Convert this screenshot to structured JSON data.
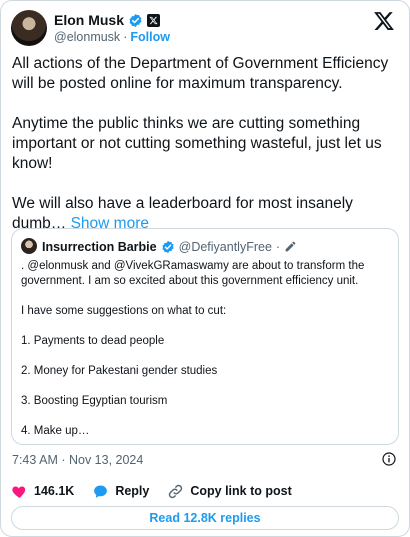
{
  "post": {
    "author_name": "Elon Musk",
    "author_handle": "@elonmusk",
    "separator": "·",
    "follow_label": "Follow",
    "paragraphs": [
      "All actions of the Department of Government Efficiency will be posted online for maximum transparency.",
      "Anytime the public thinks we are cutting something important or not cutting something wasteful, just let us know!"
    ],
    "truncated_paragraph": "We will also have a leaderboard for most insanely dumb…",
    "show_more_label": "Show more"
  },
  "quote": {
    "author_name": "Insurrection Barbie",
    "author_handle": "@DefiyantlyFree",
    "separator": "·",
    "intro": ". @elonmusk and @VivekGRamaswamy are about to transform the government. I am so excited about this government efficiency unit.",
    "lead": "I have some suggestions on what to cut:",
    "items": [
      "1.  Payments to dead people",
      "2. Money for Pakestani gender studies",
      "3. Boosting Egyptian tourism",
      "4. Make up…"
    ]
  },
  "meta": {
    "timestamp": "7:43 AM · Nov 13, 2024"
  },
  "actions": {
    "likes": "146.1K",
    "reply_label": "Reply",
    "copy_link_label": "Copy link to post",
    "read_replies_label": "Read 12.8K replies"
  },
  "colors": {
    "accent": "#1d9bf0",
    "like": "#f91880",
    "text": "#0f1419",
    "muted": "#536471",
    "border": "#cfd9de"
  },
  "icons": [
    "verified-badge-icon",
    "x-affiliate-badge-icon",
    "x-logo-icon",
    "pencil-icon",
    "info-icon",
    "heart-icon",
    "reply-bubble-icon",
    "link-icon"
  ]
}
